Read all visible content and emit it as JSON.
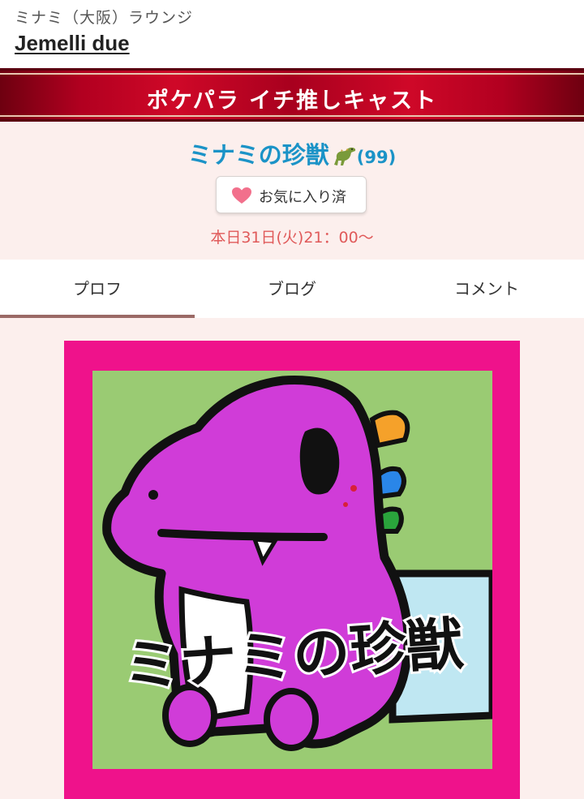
{
  "header": {
    "area_label": "ミナミ（大阪）ラウンジ",
    "shop_name": "Jemelli due"
  },
  "banner": {
    "title": "ポケパラ イチ推しキャスト"
  },
  "profile": {
    "name": "ミナミの珍獣",
    "name_emoji": "dinosaur-icon",
    "age": "(99)",
    "favorite_button_label": "お気に入り済",
    "schedule": "本日31日(火)21：00〜"
  },
  "tabs": [
    {
      "label": "プロフ",
      "active": true
    },
    {
      "label": "ブログ",
      "active": false
    },
    {
      "label": "コメント",
      "active": false
    }
  ],
  "photo": {
    "caption_text": "ミナミの珍獣"
  },
  "colors": {
    "banner": "#c0001f",
    "name": "#1b93c7",
    "schedule": "#e05a5a",
    "frame": "#ef128b",
    "background": "#fcefed",
    "heart": "#f2708c"
  }
}
